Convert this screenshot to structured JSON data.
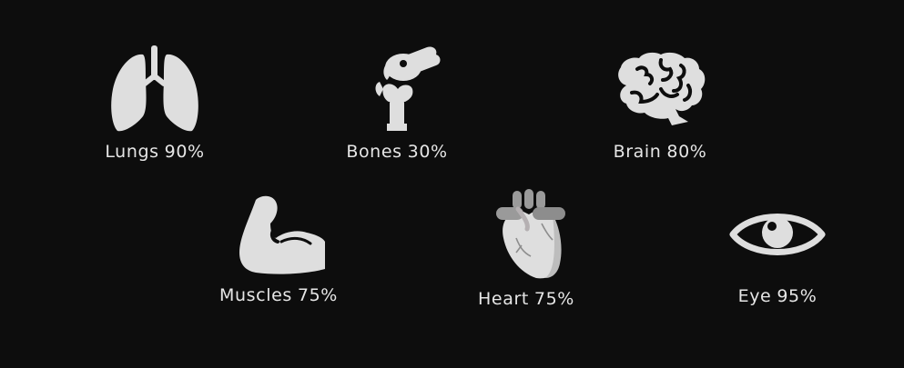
{
  "colors": {
    "background": "#0d0d0d",
    "icon_fill": "#dedede",
    "text": "#e6e6e6",
    "heart_vessels": "#8d8d8d",
    "heart_detail": "#b5b0b2"
  },
  "organs": [
    {
      "name": "Lungs",
      "percent": "90%",
      "value": 0.9,
      "icon": "lungs-icon"
    },
    {
      "name": "Bones",
      "percent": "30%",
      "value": 0.3,
      "icon": "bone-joint-icon"
    },
    {
      "name": "Brain",
      "percent": "80%",
      "value": 0.8,
      "icon": "brain-icon"
    },
    {
      "name": "Muscles",
      "percent": "75%",
      "value": 0.75,
      "icon": "flexed-arm-icon"
    },
    {
      "name": "Heart",
      "percent": "75%",
      "value": 0.75,
      "icon": "anatomical-heart-icon"
    },
    {
      "name": "Eye",
      "percent": "95%",
      "value": 0.95,
      "icon": "eye-icon"
    }
  ]
}
